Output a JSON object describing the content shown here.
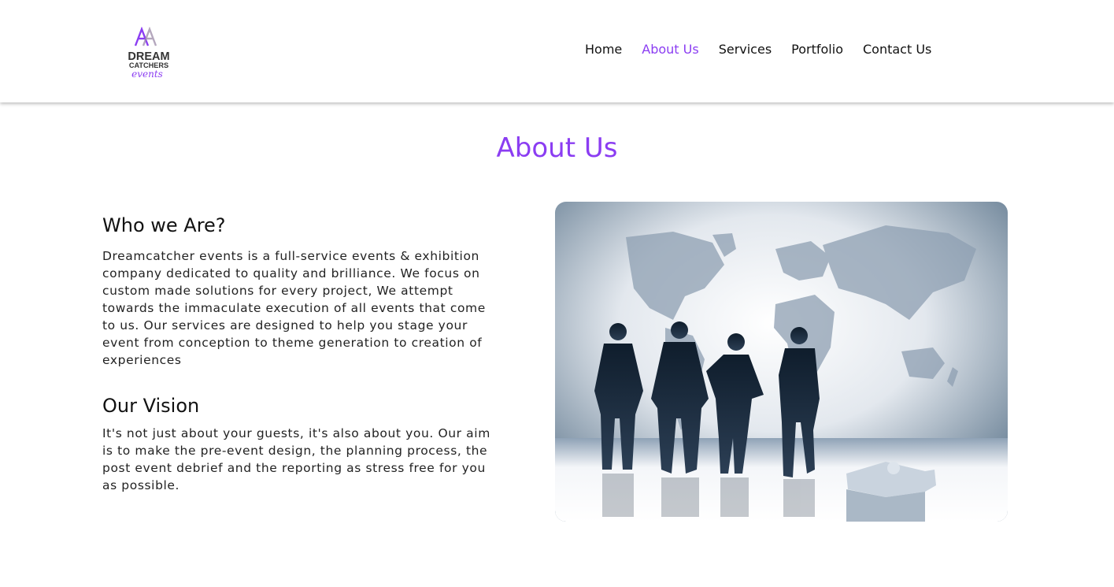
{
  "header": {
    "logo": {
      "line1": "DREAM",
      "line2": "CATCHERS",
      "line3": "events"
    },
    "nav": [
      {
        "label": "Home",
        "active": false
      },
      {
        "label": "About Us",
        "active": true
      },
      {
        "label": "Services",
        "active": false
      },
      {
        "label": "Portfolio",
        "active": false
      },
      {
        "label": "Contact Us",
        "active": false
      }
    ]
  },
  "main": {
    "title": "About Us",
    "who": {
      "heading": "Who we Are?",
      "text": "Dreamcatcher events is a full-service events & exhibition company dedicated to quality and brilliance. We focus on custom made solutions for every project, We attempt towards the immaculate execution of all events that come to us. Our services are designed to help you stage your event from conception to theme generation to creation of experiences"
    },
    "vision": {
      "heading": "Our Vision",
      "text": "It's not just about your guests, it's also about you. Our aim is to make the pre-event design, the planning process, the post event debrief and the reporting as stress free for you as possible."
    }
  },
  "colors": {
    "accent": "#8b3df2",
    "text": "#111111",
    "background": "#ffffff"
  },
  "icons": {
    "hero_image": "business-team-world-map-image",
    "logo": "dream-catchers-logo"
  }
}
